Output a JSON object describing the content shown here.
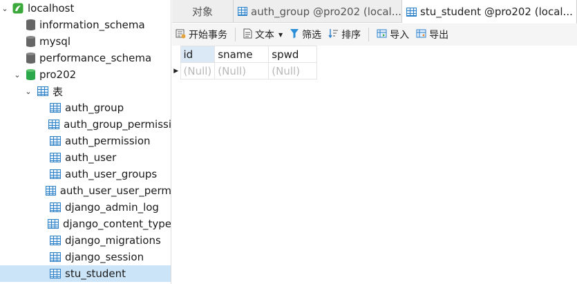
{
  "tree": {
    "connection": "localhost",
    "databases": [
      "information_schema",
      "mysql",
      "performance_schema",
      "pro202"
    ],
    "tables_folder": "表",
    "tables": [
      "auth_group",
      "auth_group_permissi",
      "auth_permission",
      "auth_user",
      "auth_user_groups",
      "auth_user_user_perm",
      "django_admin_log",
      "django_content_type",
      "django_migrations",
      "django_session",
      "stu_student"
    ]
  },
  "tabs": [
    {
      "label": "对象"
    },
    {
      "label": "auth_group @pro202 (local..."
    },
    {
      "label": "stu_student @pro202 (local..."
    }
  ],
  "toolbar": {
    "begin_transaction": "开始事务",
    "text": "文本",
    "filter": "筛选",
    "sort": "排序",
    "import": "导入",
    "export": "导出"
  },
  "grid": {
    "columns": [
      "id",
      "sname",
      "spwd"
    ],
    "rows": [
      [
        "(Null)",
        "(Null)",
        "(Null)"
      ]
    ]
  },
  "colors": {
    "selection": "#cce4f7",
    "table_icon": "#2a7fc9",
    "active_db": "#2aa84a",
    "connection_icon": "#3aa83a"
  }
}
